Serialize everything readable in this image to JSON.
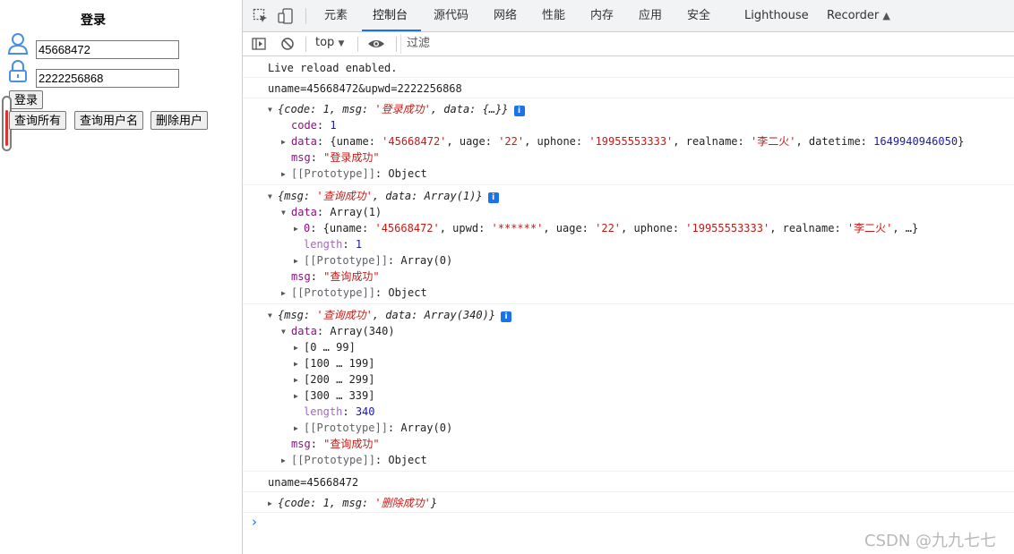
{
  "left": {
    "title": "登录",
    "username_value": "45668472",
    "password_value": "2222256868",
    "login_button": "登录",
    "query_all_button": "查询所有",
    "query_username_button": "查询用户名",
    "delete_user_button": "删除用户",
    "icons": [
      "user-icon",
      "lock-icon"
    ]
  },
  "devtools": {
    "tabs": [
      "元素",
      "控制台",
      "源代码",
      "网络",
      "性能",
      "内存",
      "应用",
      "安全",
      "Lighthouse",
      "Recorder"
    ],
    "active_tab": "控制台",
    "context": "top",
    "filter_placeholder": "过滤",
    "accent_color": "#1a73e8"
  },
  "console": {
    "m1": "Live reload enabled.",
    "m2": "uname=45668472&upwd=2222256868",
    "m3": {
      "summary_pre": "{code: 1, msg: ",
      "summary_msg": "'登录成功'",
      "summary_post": ", data: {…}}",
      "code_key": "code",
      "code_val": "1",
      "data_key": "data",
      "data_p1": ": {uname: ",
      "uname": "'45668472'",
      "data_p2": ", uage: ",
      "uage": "'22'",
      "data_p3": ", uphone: ",
      "uphone": "'19955553333'",
      "data_p4": ", realname: ",
      "realname": "'李二火'",
      "data_p5": ", datetime: ",
      "datetime": "1649940946050",
      "data_p6": "}",
      "msg_key": "msg",
      "msg_val": "\"登录成功\"",
      "proto_key": "[[Prototype]]",
      "proto_val": ": Object"
    },
    "m4": {
      "summary_pre": "{msg: ",
      "summary_msg": "'查询成功'",
      "summary_post": ", data: Array(1)}",
      "data_key": "data",
      "data_val": ": Array(1)",
      "item0_key": "0",
      "i0_p1": ": {uname: ",
      "i0_uname": "'45668472'",
      "i0_p2": ", upwd: ",
      "i0_upwd": "'******'",
      "i0_p3": ", uage: ",
      "i0_uage": "'22'",
      "i0_p4": ", uphone: ",
      "i0_uphone": "'19955553333'",
      "i0_p5": ", realname: ",
      "i0_realname": "'李二火'",
      "i0_p6": ", …}",
      "length_key": "length",
      "length_val": "1",
      "arr_proto_key": "[[Prototype]]",
      "arr_proto_val": ": Array(0)",
      "msg_key": "msg",
      "msg_val": "\"查询成功\"",
      "proto_key": "[[Prototype]]",
      "proto_val": ": Object"
    },
    "m5": {
      "summary_pre": "{msg: ",
      "summary_msg": "'查询成功'",
      "summary_post": ", data: Array(340)}",
      "data_key": "data",
      "data_val": ": Array(340)",
      "ranges": [
        "[0 … 99]",
        "[100 … 199]",
        "[200 … 299]",
        "[300 … 339]"
      ],
      "length_key": "length",
      "length_val": "340",
      "arr_proto_key": "[[Prototype]]",
      "arr_proto_val": ": Array(0)",
      "msg_key": "msg",
      "msg_val": "\"查询成功\"",
      "proto_key": "[[Prototype]]",
      "proto_val": ": Object"
    },
    "m6": "uname=45668472",
    "m7": {
      "summary_pre": "{code: 1, msg: ",
      "summary_msg": "'删除成功'",
      "summary_post": "}"
    },
    "prompt": "›"
  },
  "watermark": "CSDN @九九七七"
}
